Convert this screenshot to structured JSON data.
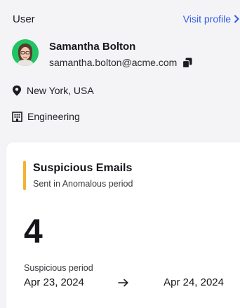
{
  "header": {
    "title": "User",
    "visit_link_label": "Visit profile"
  },
  "user": {
    "name": "Samantha Bolton",
    "email": "samantha.bolton@acme.com",
    "location": "New York, USA",
    "department": "Engineering",
    "avatar_bg": "#20c463"
  },
  "icons": {
    "visit": "chevron-right-icon",
    "copy": "copy-icon",
    "location": "location-pin-icon",
    "department": "building-icon"
  },
  "card": {
    "title": "Suspicious Emails",
    "subtitle": "Sent in Anomalous period",
    "count": "4",
    "period_label": "Suspicious period",
    "period_start": "Apr 23, 2024",
    "period_end": "Apr 24, 2024",
    "accent_color": "#f2b233"
  },
  "colors": {
    "link": "#2f5be8",
    "background": "#f4f4f6",
    "card_background": "#ffffff"
  }
}
